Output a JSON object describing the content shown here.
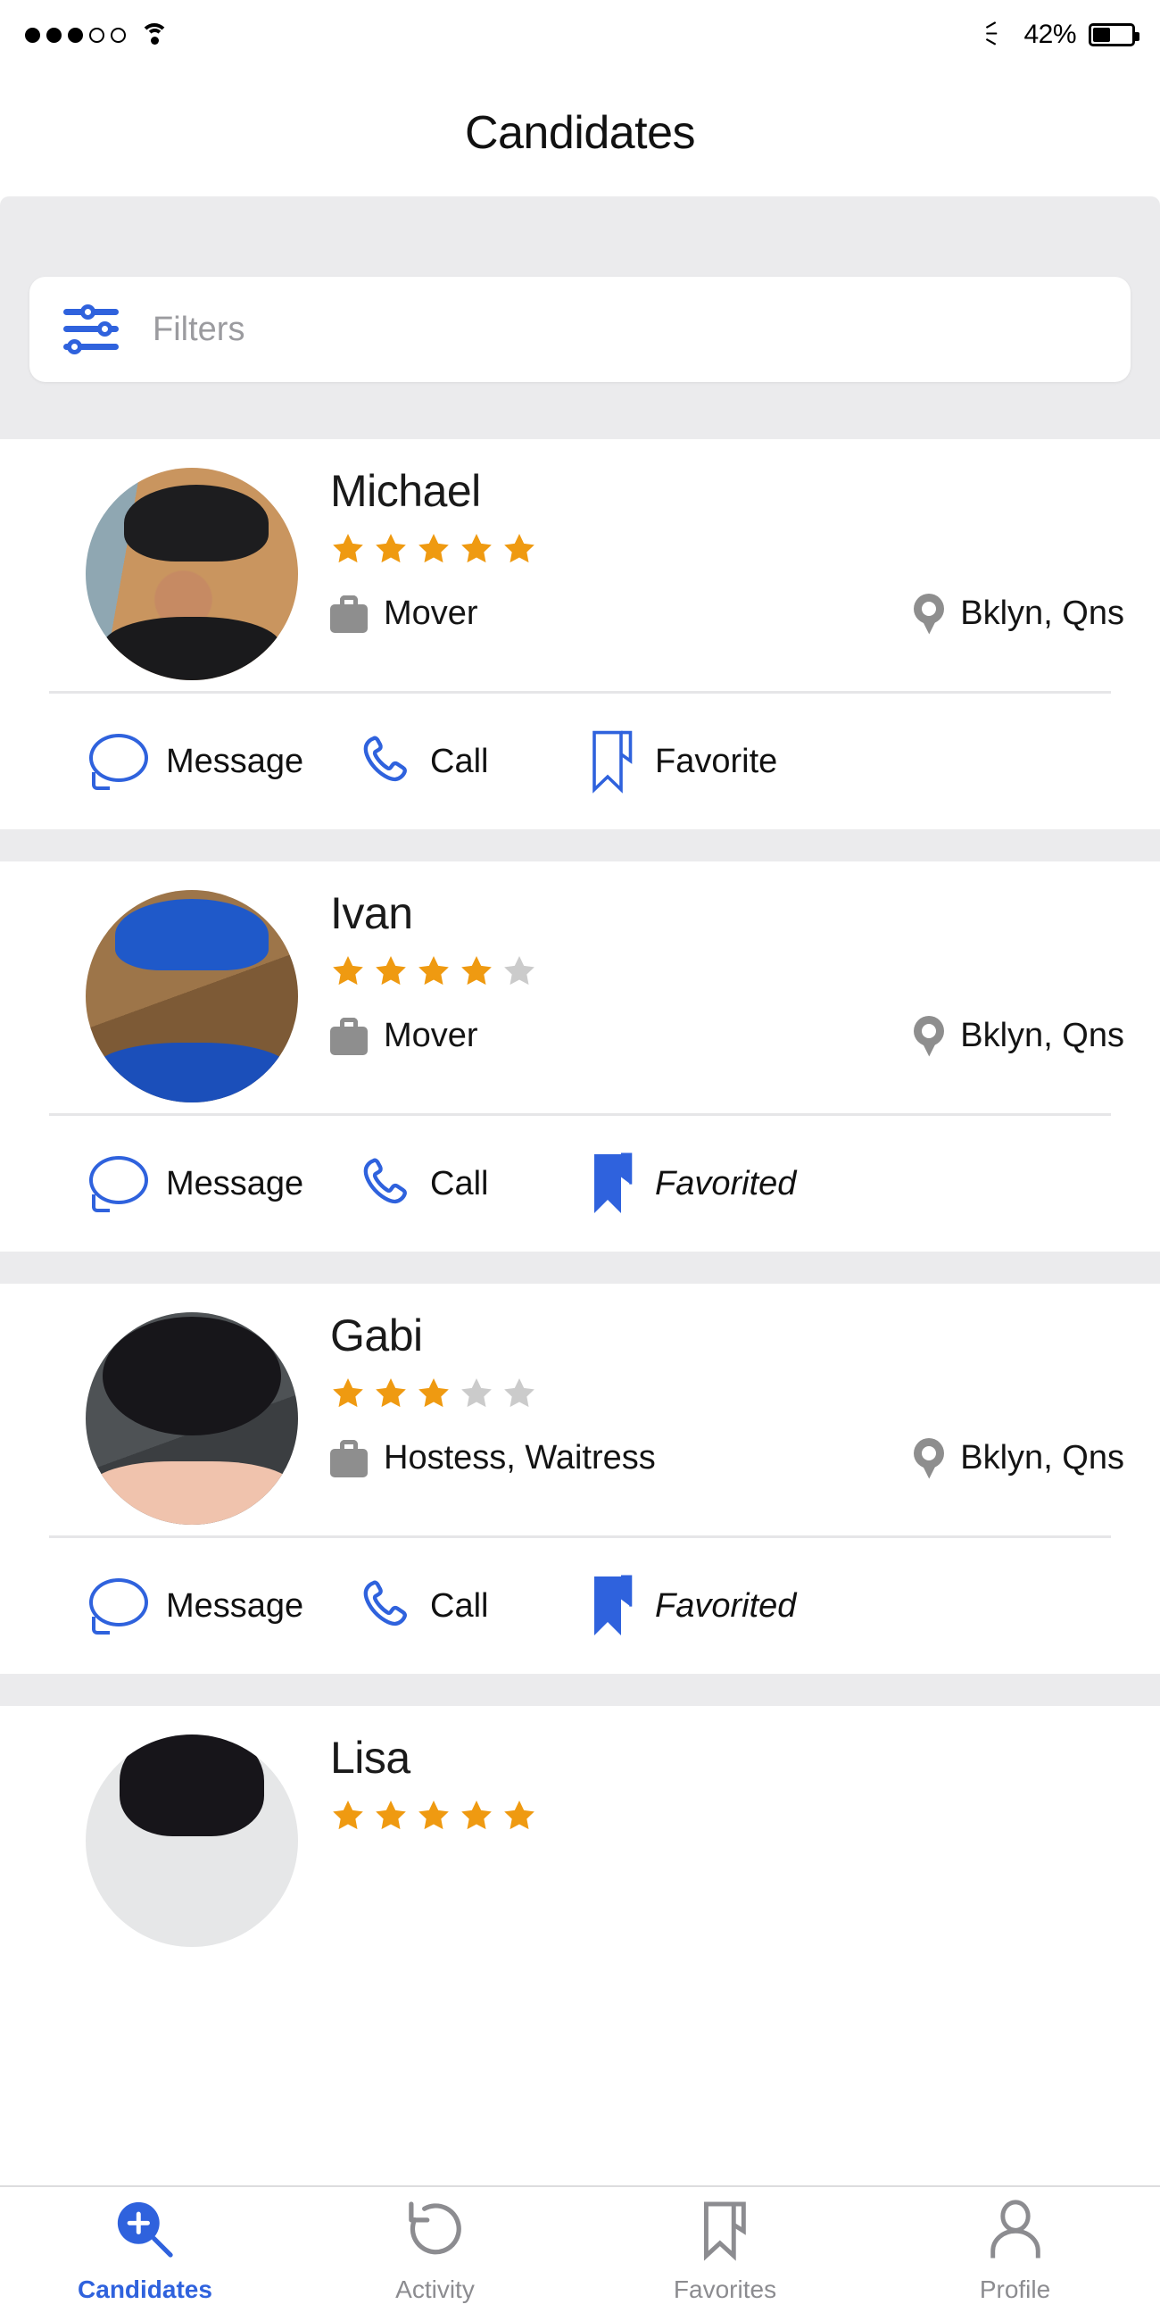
{
  "status_bar": {
    "signal_filled": 3,
    "signal_total": 5,
    "wifi_icon": "wifi-icon",
    "bluetooth_icon": "bluetooth-icon",
    "battery_percent": "42%",
    "battery_level": 42
  },
  "header": {
    "title": "Candidates"
  },
  "search": {
    "placeholder": "Filters",
    "icon": "sliders-filter-icon",
    "value": ""
  },
  "candidates": [
    {
      "name": "Michael",
      "rating": 5,
      "max_rating": 5,
      "job": "Mover",
      "location": "Bklyn, Qns",
      "avatar": "av-michael",
      "actions": {
        "message": "Message",
        "call": "Call",
        "favorite": "Favorite",
        "favorited": false
      }
    },
    {
      "name": "Ivan",
      "rating": 4,
      "max_rating": 5,
      "job": "Mover",
      "location": "Bklyn, Qns",
      "avatar": "av-ivan",
      "actions": {
        "message": "Message",
        "call": "Call",
        "favorite": "Favorited",
        "favorited": true
      }
    },
    {
      "name": "Gabi",
      "rating": 3,
      "max_rating": 5,
      "job": "Hostess, Waitress",
      "location": "Bklyn, Qns",
      "avatar": "av-gabi",
      "actions": {
        "message": "Message",
        "call": "Call",
        "favorite": "Favorited",
        "favorited": true
      }
    },
    {
      "name": "Lisa",
      "rating": 5,
      "max_rating": 5,
      "job": "",
      "location": "",
      "avatar": "av-lisa",
      "actions": {
        "message": "",
        "call": "",
        "favorite": "",
        "favorited": false
      }
    }
  ],
  "tabs": [
    {
      "label": "Candidates",
      "icon": "search-plus-icon",
      "active": true
    },
    {
      "label": "Activity",
      "icon": "undo-arrow-icon",
      "active": false
    },
    {
      "label": "Favorites",
      "icon": "bookmark-icon",
      "active": false
    },
    {
      "label": "Profile",
      "icon": "person-icon",
      "active": false
    }
  ],
  "colors": {
    "accent_blue": "#2f62dd",
    "star_orange": "#ef9a11",
    "star_grey": "#cbcbcb",
    "icon_grey": "#8e8e8e",
    "band_grey": "#ebebed"
  }
}
